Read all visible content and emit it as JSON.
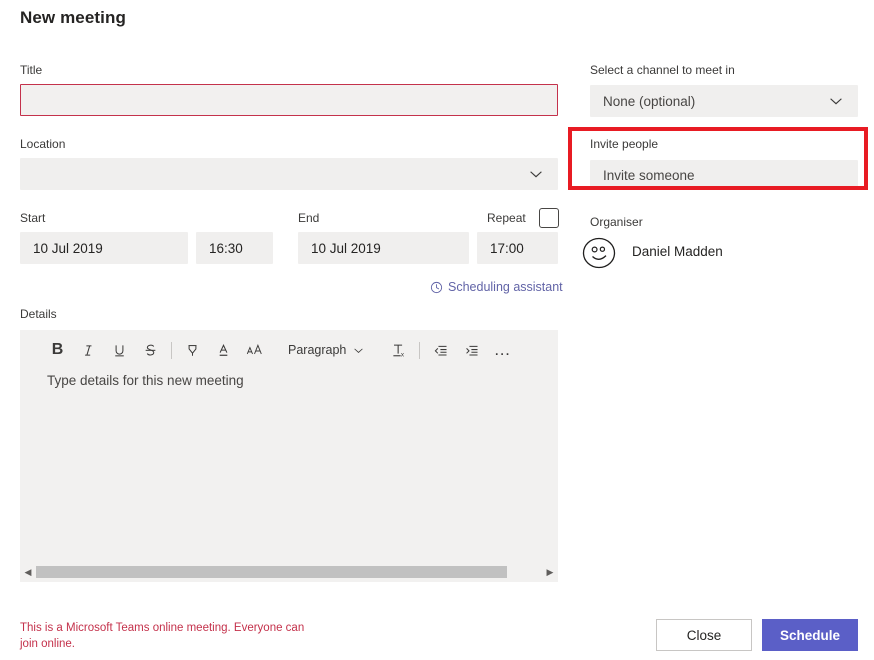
{
  "header": {
    "title": "New meeting"
  },
  "form": {
    "title_label": "Title",
    "title_value": "",
    "location_label": "Location",
    "location_value": "",
    "start_label": "Start",
    "start_date": "10 Jul 2019",
    "start_time": "16:30",
    "end_label": "End",
    "end_date": "10 Jul 2019",
    "end_time": "17:00",
    "repeat_label": "Repeat",
    "repeat_checked": false,
    "scheduling_assistant_label": "Scheduling assistant",
    "details_label": "Details"
  },
  "editor": {
    "placeholder": "Type details for this new meeting",
    "paragraph_style": "Paragraph",
    "toolbar": [
      {
        "name": "bold-icon",
        "glyph": "B"
      },
      {
        "name": "italic-icon",
        "glyph": "I"
      },
      {
        "name": "underline-icon",
        "glyph": "U"
      },
      {
        "name": "strikethrough-icon",
        "glyph": "S"
      },
      {
        "name": "highlight-icon",
        "glyph": "marker"
      },
      {
        "name": "font-color-icon",
        "glyph": "A"
      },
      {
        "name": "font-size-icon",
        "glyph": "aA"
      },
      {
        "name": "clear-formatting-icon",
        "glyph": "Tx"
      },
      {
        "name": "decrease-indent-icon",
        "glyph": "indent-left"
      },
      {
        "name": "increase-indent-icon",
        "glyph": "indent-right"
      },
      {
        "name": "more-options-icon",
        "glyph": "..."
      }
    ]
  },
  "right": {
    "channel_label": "Select a channel to meet in",
    "channel_value": "None (optional)",
    "invite_label": "Invite people",
    "invite_placeholder": "Invite someone",
    "organiser_label": "Organiser",
    "organiser_name": "Daniel Madden"
  },
  "footer": {
    "note": "This is a Microsoft Teams online meeting. Everyone can join online.",
    "close_label": "Close",
    "schedule_label": "Schedule"
  },
  "colors": {
    "accent_purple": "#5b5fc7",
    "link_purple": "#6264a7",
    "error_red": "#c4314b",
    "highlight_red": "#e81b23",
    "field_bg": "#f0efee"
  }
}
